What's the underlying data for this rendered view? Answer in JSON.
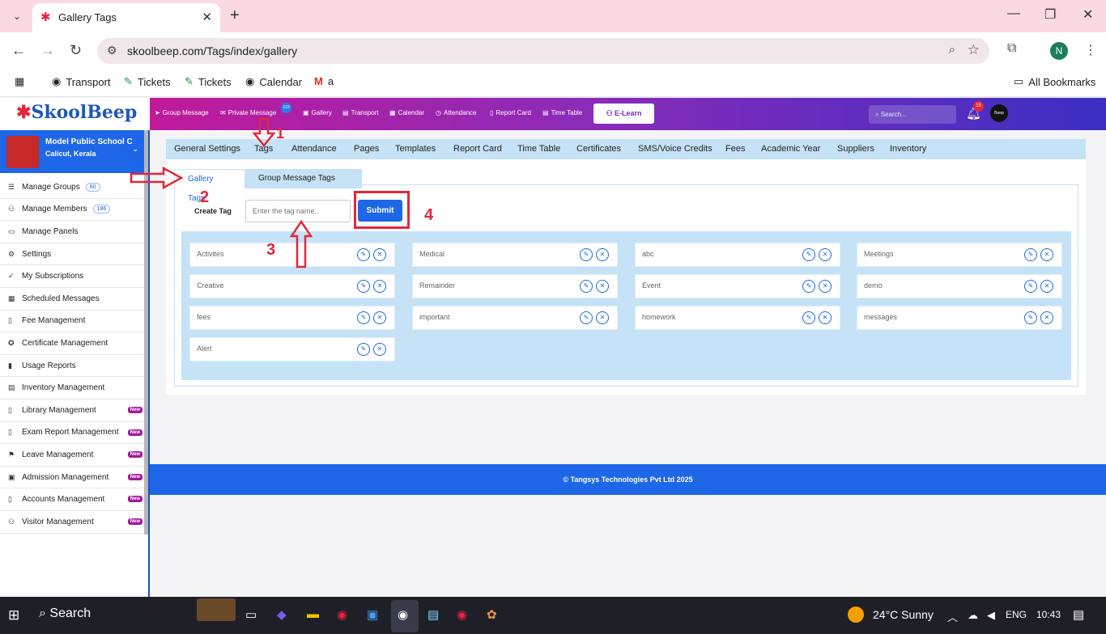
{
  "browser": {
    "tab_title": "Gallery Tags",
    "url": "skoolbeep.com/Tags/index/gallery",
    "profile_initial": "N",
    "bookmarks": [
      "Transport",
      "Tickets",
      "Tickets",
      "Calendar",
      "a"
    ],
    "all_bookmarks": "All Bookmarks"
  },
  "app": {
    "logo": "SkoolBeep",
    "topnav": [
      "Group Message",
      "Private Message",
      "Gallery",
      "Transport",
      "Calendar",
      "Attendance",
      "Report Card",
      "Time Table"
    ],
    "private_badge": "123",
    "elearn": "E-Learn",
    "search_placeholder": "Search...",
    "notif_count": "15",
    "avatar_text": "Beep"
  },
  "school": {
    "name": "Model Public School C",
    "location": "Calicut, Kerala"
  },
  "sidebar": [
    {
      "label": "Manage Groups",
      "count": "60",
      "icon": "list-icon"
    },
    {
      "label": "Manage Members",
      "count": "186",
      "icon": "users-icon"
    },
    {
      "label": "Manage Panels",
      "icon": "monitor-icon"
    },
    {
      "label": "Settings",
      "icon": "gear-icon"
    },
    {
      "label": "My Subscriptions",
      "icon": "check-icon"
    },
    {
      "label": "Scheduled Messages",
      "icon": "calendar-icon"
    },
    {
      "label": "Fee Management",
      "icon": "doc-icon"
    },
    {
      "label": "Certificate Management",
      "icon": "certificate-icon"
    },
    {
      "label": "Usage Reports",
      "icon": "chart-icon"
    },
    {
      "label": "Inventory Management",
      "icon": "inventory-icon"
    },
    {
      "label": "Library Management",
      "new": "New",
      "icon": "book-icon"
    },
    {
      "label": "Exam Report Management",
      "new": "New",
      "icon": "doc-icon"
    },
    {
      "label": "Leave Management",
      "new": "New",
      "icon": "leave-icon"
    },
    {
      "label": "Admission Management",
      "new": "New",
      "icon": "admission-icon"
    },
    {
      "label": "Accounts Management",
      "new": "New",
      "icon": "doc-icon"
    },
    {
      "label": "Visitor Management",
      "new": "New",
      "icon": "users-icon"
    }
  ],
  "subnav": [
    "General Settings",
    "Tags",
    "Attendance",
    "Pages",
    "Templates",
    "Report Card",
    "Time Table",
    "Certificates",
    "SMS/Voice Credits",
    "Fees",
    "Academic Year",
    "Suppliers",
    "Inventory"
  ],
  "tag_tabs": {
    "active": "Gallery Tags",
    "other": "Group Message Tags"
  },
  "form": {
    "label": "Create Tag",
    "placeholder": "Enter the tag name..",
    "submit": "Submit"
  },
  "tags": [
    "Activites",
    "Medical",
    "abc",
    "Meetings",
    "Creative",
    "Remainder",
    "Event",
    "demo",
    "fees",
    "important",
    "homework",
    "messages",
    "Alert"
  ],
  "annotations": [
    "1",
    "2",
    "3",
    "4"
  ],
  "footer": "© Tangsys Technologies Pvt Ltd 2025",
  "taskbar": {
    "search": "Search",
    "weather": "24°C  Sunny",
    "lang": "ENG",
    "time": "10:43"
  }
}
